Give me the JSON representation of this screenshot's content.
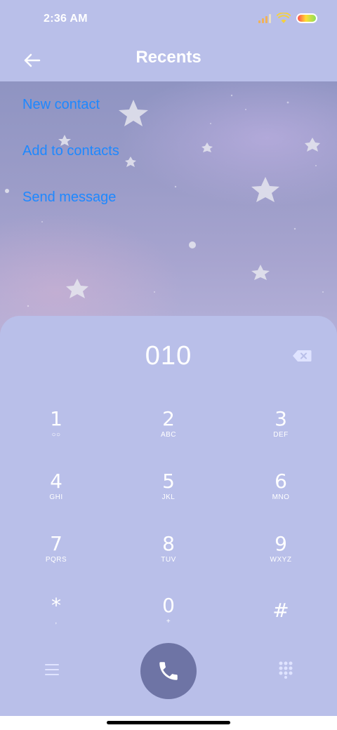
{
  "status_bar": {
    "time": "2:36 AM",
    "icons": [
      "signal-icon",
      "wifi-icon",
      "battery-icon"
    ]
  },
  "header": {
    "title": "Recents",
    "back_icon": "arrow-left-icon"
  },
  "actions": [
    {
      "label": "New contact"
    },
    {
      "label": "Add to contacts"
    },
    {
      "label": "Send message"
    }
  ],
  "dialpad": {
    "number": "010",
    "backspace_icon": "backspace-icon",
    "keys": [
      {
        "digit": "1",
        "letters": "○○"
      },
      {
        "digit": "2",
        "letters": "ABC"
      },
      {
        "digit": "3",
        "letters": "DEF"
      },
      {
        "digit": "4",
        "letters": "GHI"
      },
      {
        "digit": "5",
        "letters": "JKL"
      },
      {
        "digit": "6",
        "letters": "MNO"
      },
      {
        "digit": "7",
        "letters": "PQRS"
      },
      {
        "digit": "8",
        "letters": "TUV"
      },
      {
        "digit": "9",
        "letters": "WXYZ"
      },
      {
        "digit": "*",
        "letters": ","
      },
      {
        "digit": "0",
        "letters": "+"
      },
      {
        "digit": "#",
        "letters": ""
      }
    ]
  },
  "bottom_actions": {
    "menu_icon": "menu-icon",
    "call_icon": "phone-icon",
    "keypad_icon": "keypad-icon"
  },
  "colors": {
    "background": "#b9bfe9",
    "accent_link": "#1e88ff",
    "call_button": "#6e74a5"
  }
}
